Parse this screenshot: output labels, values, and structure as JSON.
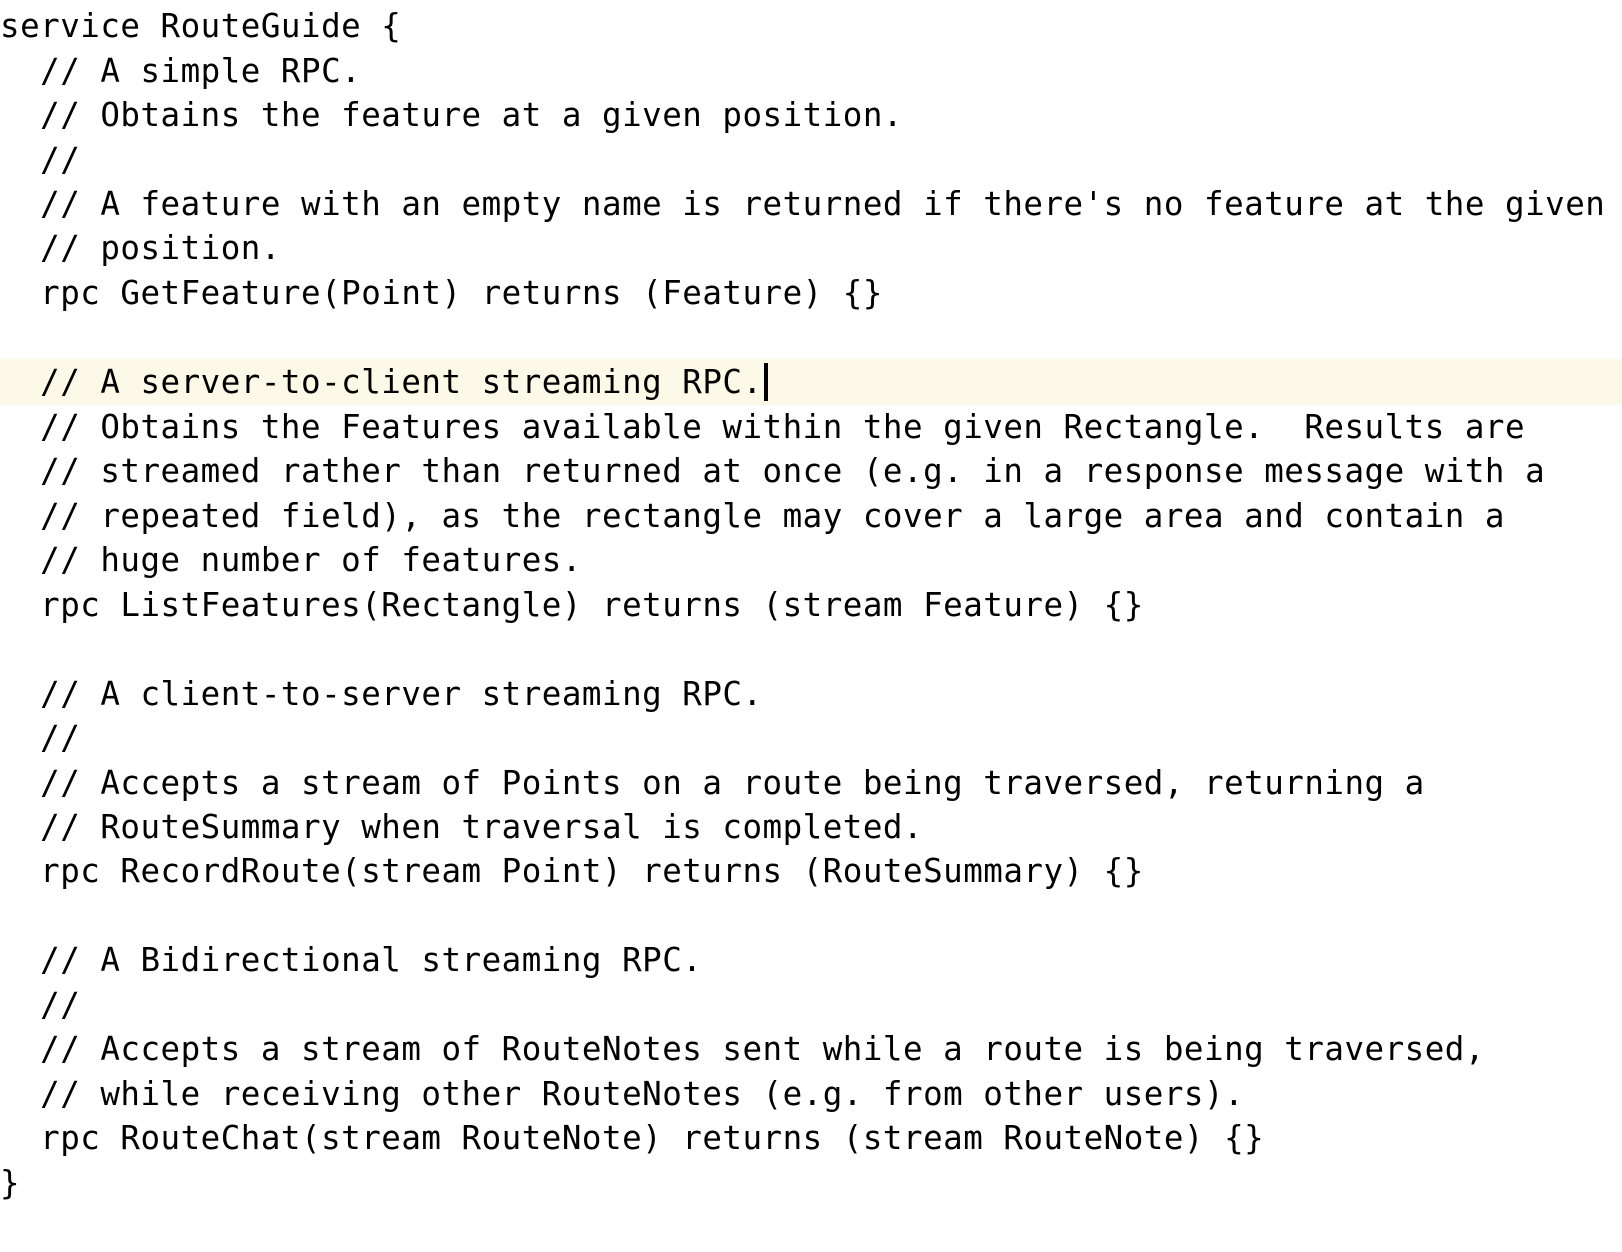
{
  "editor": {
    "current_line_index": 8,
    "caret_after_text": true,
    "current_line_bg": "#fdf9e8",
    "lines": [
      {
        "text": "service RouteGuide {",
        "kind": "code"
      },
      {
        "text": "  // A simple RPC.",
        "kind": "comment"
      },
      {
        "text": "  // Obtains the feature at a given position.",
        "kind": "comment"
      },
      {
        "text": "  //",
        "kind": "comment"
      },
      {
        "text": "  // A feature with an empty name is returned if there's no feature at the given",
        "kind": "comment"
      },
      {
        "text": "  // position.",
        "kind": "comment"
      },
      {
        "text": "  rpc GetFeature(Point) returns (Feature) {}",
        "kind": "code"
      },
      {
        "text": "",
        "kind": "blank"
      },
      {
        "text": "  // A server-to-client streaming RPC.",
        "kind": "comment"
      },
      {
        "text": "  // Obtains the Features available within the given Rectangle.  Results are",
        "kind": "comment"
      },
      {
        "text": "  // streamed rather than returned at once (e.g. in a response message with a",
        "kind": "comment"
      },
      {
        "text": "  // repeated field), as the rectangle may cover a large area and contain a",
        "kind": "comment"
      },
      {
        "text": "  // huge number of features.",
        "kind": "comment"
      },
      {
        "text": "  rpc ListFeatures(Rectangle) returns (stream Feature) {}",
        "kind": "code"
      },
      {
        "text": "",
        "kind": "blank"
      },
      {
        "text": "  // A client-to-server streaming RPC.",
        "kind": "comment"
      },
      {
        "text": "  //",
        "kind": "comment"
      },
      {
        "text": "  // Accepts a stream of Points on a route being traversed, returning a",
        "kind": "comment"
      },
      {
        "text": "  // RouteSummary when traversal is completed.",
        "kind": "comment"
      },
      {
        "text": "  rpc RecordRoute(stream Point) returns (RouteSummary) {}",
        "kind": "code"
      },
      {
        "text": "",
        "kind": "blank"
      },
      {
        "text": "  // A Bidirectional streaming RPC.",
        "kind": "comment"
      },
      {
        "text": "  //",
        "kind": "comment"
      },
      {
        "text": "  // Accepts a stream of RouteNotes sent while a route is being traversed,",
        "kind": "comment"
      },
      {
        "text": "  // while receiving other RouteNotes (e.g. from other users).",
        "kind": "comment"
      },
      {
        "text": "  rpc RouteChat(stream RouteNote) returns (stream RouteNote) {}",
        "kind": "code"
      },
      {
        "text": "}",
        "kind": "code"
      }
    ]
  }
}
